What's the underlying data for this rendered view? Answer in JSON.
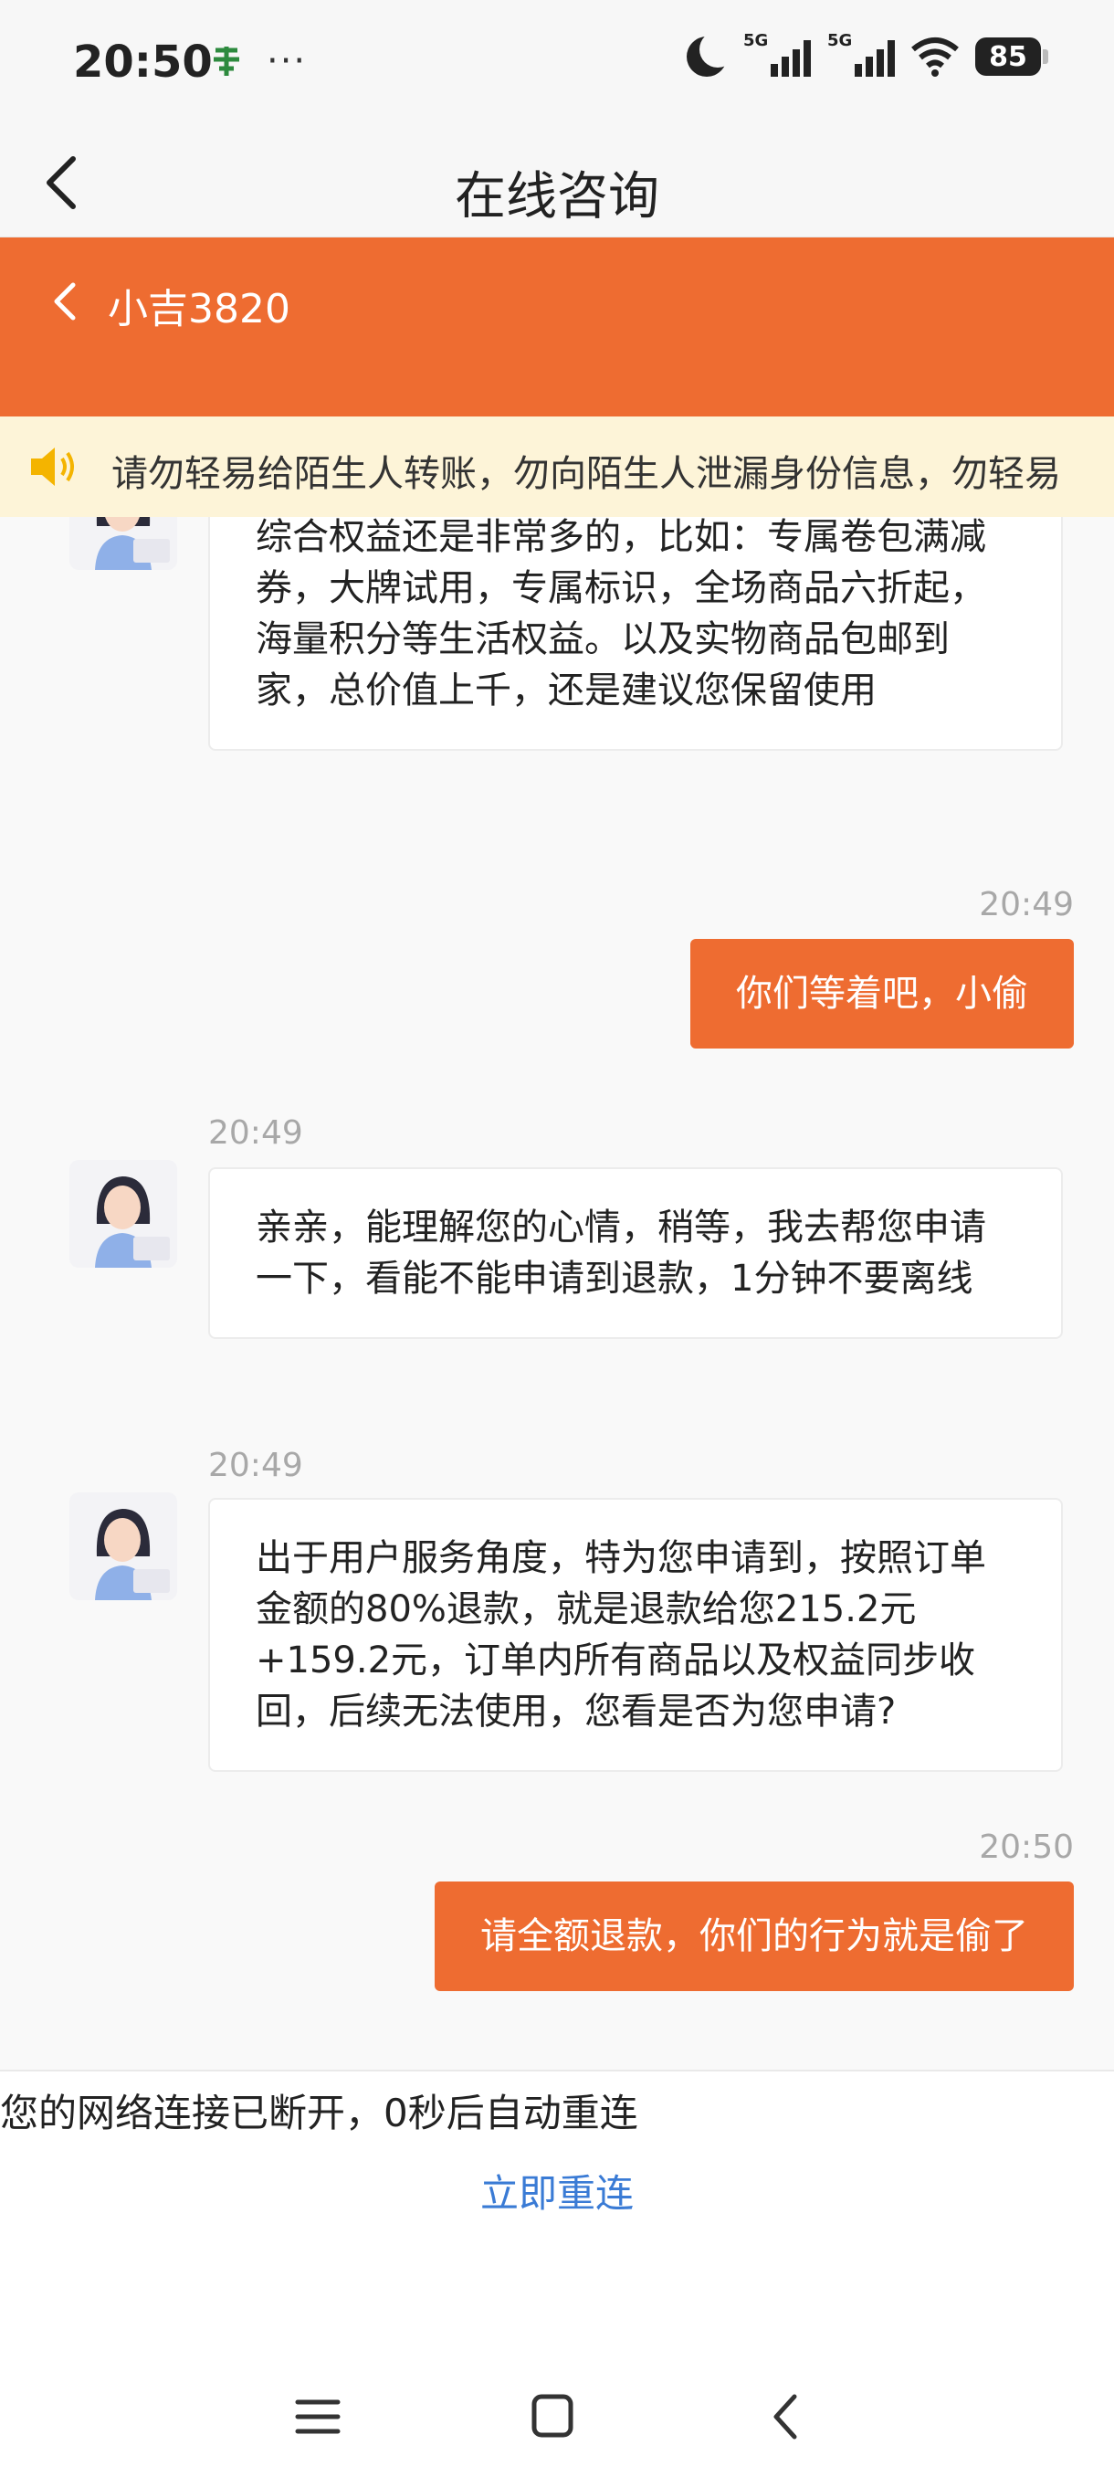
{
  "status_bar": {
    "time": "20:50",
    "more": "···",
    "network_1": "5G",
    "network_2": "5G",
    "battery": "85"
  },
  "titlebar": {
    "title": "在线咨询"
  },
  "chat_header": {
    "agent_name": "小吉3820"
  },
  "notice": {
    "text": "请勿轻易给陌生人转账，勿向陌生人泄漏身份信息，勿轻易"
  },
  "messages": [
    {
      "from": "agent",
      "time": "",
      "text": "亲亲，理解您的心情呢，这两笔订单开通后，综合权益还是非常多的，比如：专属卷包满减券，大牌试用，专属标识，全场商品六折起，海量积分等生活权益。以及实物商品包邮到家，总价值上千，还是建议您保留使用"
    },
    {
      "from": "user",
      "time": "20:49",
      "text": "你们等着吧，小偷"
    },
    {
      "from": "agent",
      "time": "20:49",
      "text": "亲亲，能理解您的心情，稍等，我去帮您申请一下，看能不能申请到退款，1分钟不要离线"
    },
    {
      "from": "agent",
      "time": "20:49",
      "text": "出于用户服务角度，特为您申请到，按照订单金额的80%退款，就是退款给您215.2元+159.2元，订单内所有商品以及权益同步收回，后续无法使用，您看是否为您申请?"
    },
    {
      "from": "user",
      "time": "20:50",
      "text": "请全额退款，你们的行为就是偷了"
    }
  ],
  "connection": {
    "status_text": "您的网络连接已断开，0秒后自动重连",
    "reconnect_label": "立即重连"
  },
  "colors": {
    "accent": "#ee6c31",
    "notice_bg": "#fdf4d8",
    "link": "#3a7bd5"
  }
}
